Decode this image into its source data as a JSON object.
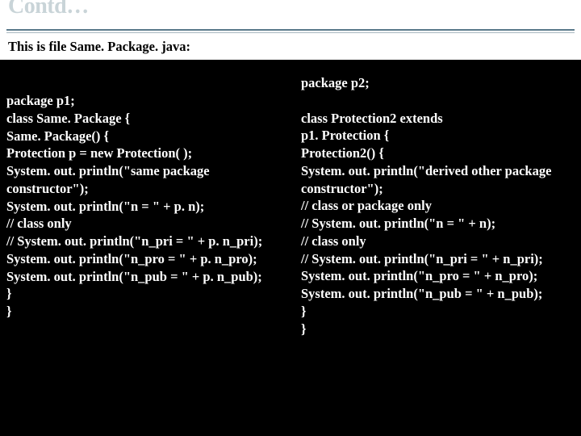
{
  "title": "Contd…",
  "subtitle": "This is file Same. Package. java:",
  "left_code": "package p1;\nclass Same. Package {\nSame. Package() {\nProtection p = new Protection( );\nSystem. out. println(\"same package constructor\");\nSystem. out. println(\"n = \" + p. n);\n// class only\n// System. out. println(\"n_pri = \" + p. n_pri);\nSystem. out. println(\"n_pro = \" + p. n_pro);\nSystem. out. println(\"n_pub = \" + p. n_pub);\n}\n}",
  "right_code": "package p2;\n\nclass Protection2 extends\np1. Protection {\nProtection2() {\nSystem. out. println(\"derived other package constructor\");\n// class or package only\n// System. out. println(\"n = \" + n);\n// class only\n// System. out. println(\"n_pri = \" + n_pri);\nSystem. out. println(\"n_pro = \" + n_pro);\nSystem. out. println(\"n_pub = \" + n_pub);\n}\n}"
}
